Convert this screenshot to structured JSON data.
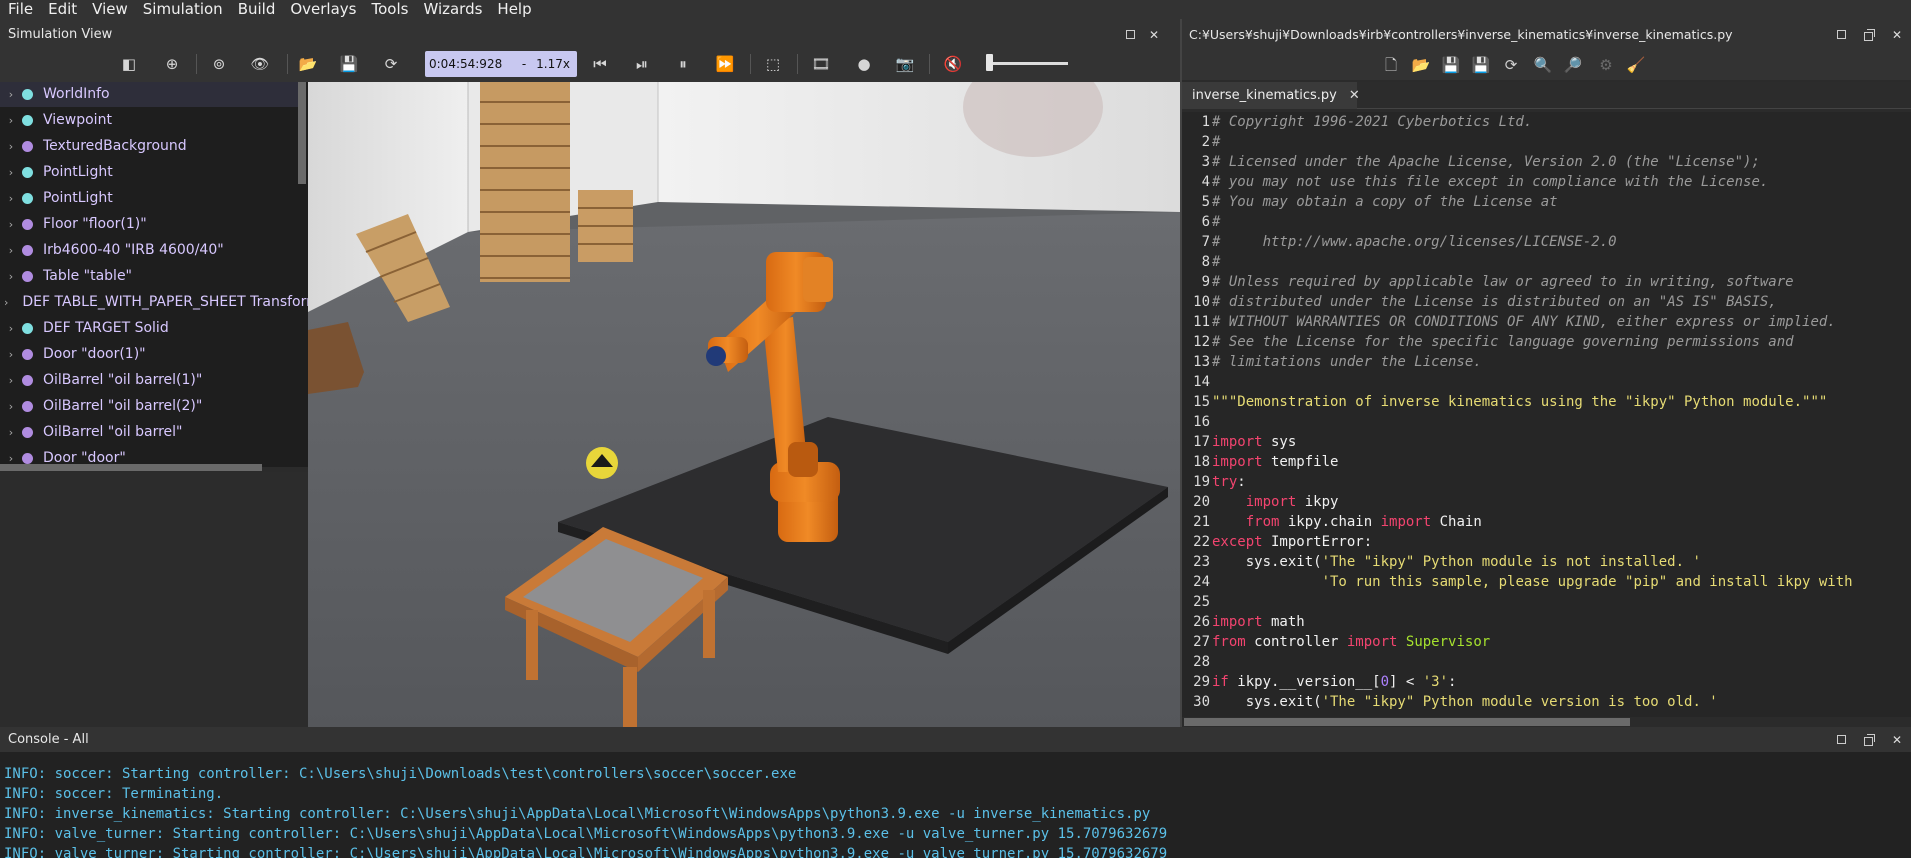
{
  "menu": [
    "File",
    "Edit",
    "View",
    "Simulation",
    "Build",
    "Overlays",
    "Tools",
    "Wizards",
    "Help"
  ],
  "simulation_panel": {
    "title": "Simulation View"
  },
  "sim_toolbar": {
    "time": "0:04:54:928",
    "separator": "-",
    "speed": "1.17x"
  },
  "scene_tree": [
    {
      "label": "WorldInfo",
      "color": "#7fdfe0",
      "selected": true
    },
    {
      "label": "Viewpoint",
      "color": "#7fdfe0"
    },
    {
      "label": "TexturedBackground",
      "color": "#b08ce0"
    },
    {
      "label": "PointLight",
      "color": "#7fdfe0"
    },
    {
      "label": "PointLight",
      "color": "#7fdfe0"
    },
    {
      "label": "Floor \"floor(1)\"",
      "color": "#b08ce0"
    },
    {
      "label": "Irb4600-40 \"IRB 4600/40\"",
      "color": "#b08ce0"
    },
    {
      "label": "Table \"table\"",
      "color": "#b08ce0"
    },
    {
      "label": "DEF TABLE_WITH_PAPER_SHEET Transform",
      "color": "#7fdfe0"
    },
    {
      "label": "DEF TARGET Solid",
      "color": "#7fdfe0"
    },
    {
      "label": "Door \"door(1)\"",
      "color": "#b08ce0"
    },
    {
      "label": "OilBarrel \"oil barrel(1)\"",
      "color": "#b08ce0"
    },
    {
      "label": "OilBarrel \"oil barrel(2)\"",
      "color": "#b08ce0"
    },
    {
      "label": "OilBarrel \"oil barrel\"",
      "color": "#b08ce0"
    },
    {
      "label": "Door \"door\"",
      "color": "#b08ce0"
    }
  ],
  "editor": {
    "path": "C:¥Users¥shuji¥Downloads¥irb¥controllers¥inverse_kinematics¥inverse_kinematics.py",
    "tab": "inverse_kinematics.py",
    "lines": [
      [
        [
          "cm",
          "# Copyright 1996-2021 Cyberbotics Ltd."
        ]
      ],
      [
        [
          "cm",
          "#"
        ]
      ],
      [
        [
          "cm",
          "# Licensed under the Apache License, Version 2.0 (the \"License\");"
        ]
      ],
      [
        [
          "cm",
          "# you may not use this file except in compliance with the License."
        ]
      ],
      [
        [
          "cm",
          "# You may obtain a copy of the License at"
        ]
      ],
      [
        [
          "cm",
          "#"
        ]
      ],
      [
        [
          "cm",
          "#     http://www.apache.org/licenses/LICENSE-2.0"
        ]
      ],
      [
        [
          "cm",
          "#"
        ]
      ],
      [
        [
          "cm",
          "# Unless required by applicable law or agreed to in writing, software"
        ]
      ],
      [
        [
          "cm",
          "# distributed under the License is distributed on an \"AS IS\" BASIS,"
        ]
      ],
      [
        [
          "cm",
          "# WITHOUT WARRANTIES OR CONDITIONS OF ANY KIND, either express or implied."
        ]
      ],
      [
        [
          "cm",
          "# See the License for the specific language governing permissions and"
        ]
      ],
      [
        [
          "cm",
          "# limitations under the License."
        ]
      ],
      [
        [
          "tx",
          ""
        ]
      ],
      [
        [
          "st",
          "\"\"\"Demonstration of inverse kinematics using the \"ikpy\" Python module.\"\"\""
        ]
      ],
      [
        [
          "tx",
          ""
        ]
      ],
      [
        [
          "kw",
          "import"
        ],
        [
          "tx",
          " sys"
        ]
      ],
      [
        [
          "kw",
          "import"
        ],
        [
          "tx",
          " tempfile"
        ]
      ],
      [
        [
          "kw",
          "try"
        ],
        [
          "tx",
          ":"
        ]
      ],
      [
        [
          "tx",
          "    "
        ],
        [
          "kw",
          "import"
        ],
        [
          "tx",
          " ikpy"
        ]
      ],
      [
        [
          "tx",
          "    "
        ],
        [
          "kw",
          "from"
        ],
        [
          "tx",
          " ikpy.chain "
        ],
        [
          "kw",
          "import"
        ],
        [
          "tx",
          " Chain"
        ]
      ],
      [
        [
          "kw",
          "except"
        ],
        [
          "tx",
          " ImportError:"
        ]
      ],
      [
        [
          "tx",
          "    sys.exit("
        ],
        [
          "st",
          "'The \"ikpy\" Python module is not installed. '"
        ]
      ],
      [
        [
          "tx",
          "             "
        ],
        [
          "st",
          "'To run this sample, please upgrade \"pip\" and install ikpy with"
        ]
      ],
      [
        [
          "tx",
          ""
        ]
      ],
      [
        [
          "kw",
          "import"
        ],
        [
          "tx",
          " math"
        ]
      ],
      [
        [
          "kw",
          "from"
        ],
        [
          "tx",
          " controller "
        ],
        [
          "kw",
          "import"
        ],
        [
          "tx",
          " "
        ],
        [
          "cls",
          "Supervisor"
        ]
      ],
      [
        [
          "tx",
          ""
        ]
      ],
      [
        [
          "kw",
          "if"
        ],
        [
          "tx",
          " ikpy.__version__["
        ],
        [
          "nm",
          "0"
        ],
        [
          "tx",
          "] < "
        ],
        [
          "st",
          "'3'"
        ],
        [
          "tx",
          ":"
        ]
      ],
      [
        [
          "tx",
          "    sys.exit("
        ],
        [
          "st",
          "'The \"ikpy\" Python module version is too old. '"
        ]
      ]
    ]
  },
  "console": {
    "title": "Console - All",
    "lines": [
      "INFO: soccer: Starting controller: C:\\Users\\shuji\\Downloads\\test\\controllers\\soccer\\soccer.exe",
      "INFO: soccer: Terminating.",
      "INFO: inverse_kinematics: Starting controller: C:\\Users\\shuji\\AppData\\Local\\Microsoft\\WindowsApps\\python3.9.exe -u inverse_kinematics.py",
      "INFO: valve_turner: Starting controller: C:\\Users\\shuji\\AppData\\Local\\Microsoft\\WindowsApps\\python3.9.exe -u valve_turner.py 15.7079632679",
      "INFO: valve_turner: Starting controller: C:\\Users\\shuji\\AppData\\Local\\Microsoft\\WindowsApps\\python3.9.exe -u valve_turner.py 15.7079632679"
    ]
  }
}
